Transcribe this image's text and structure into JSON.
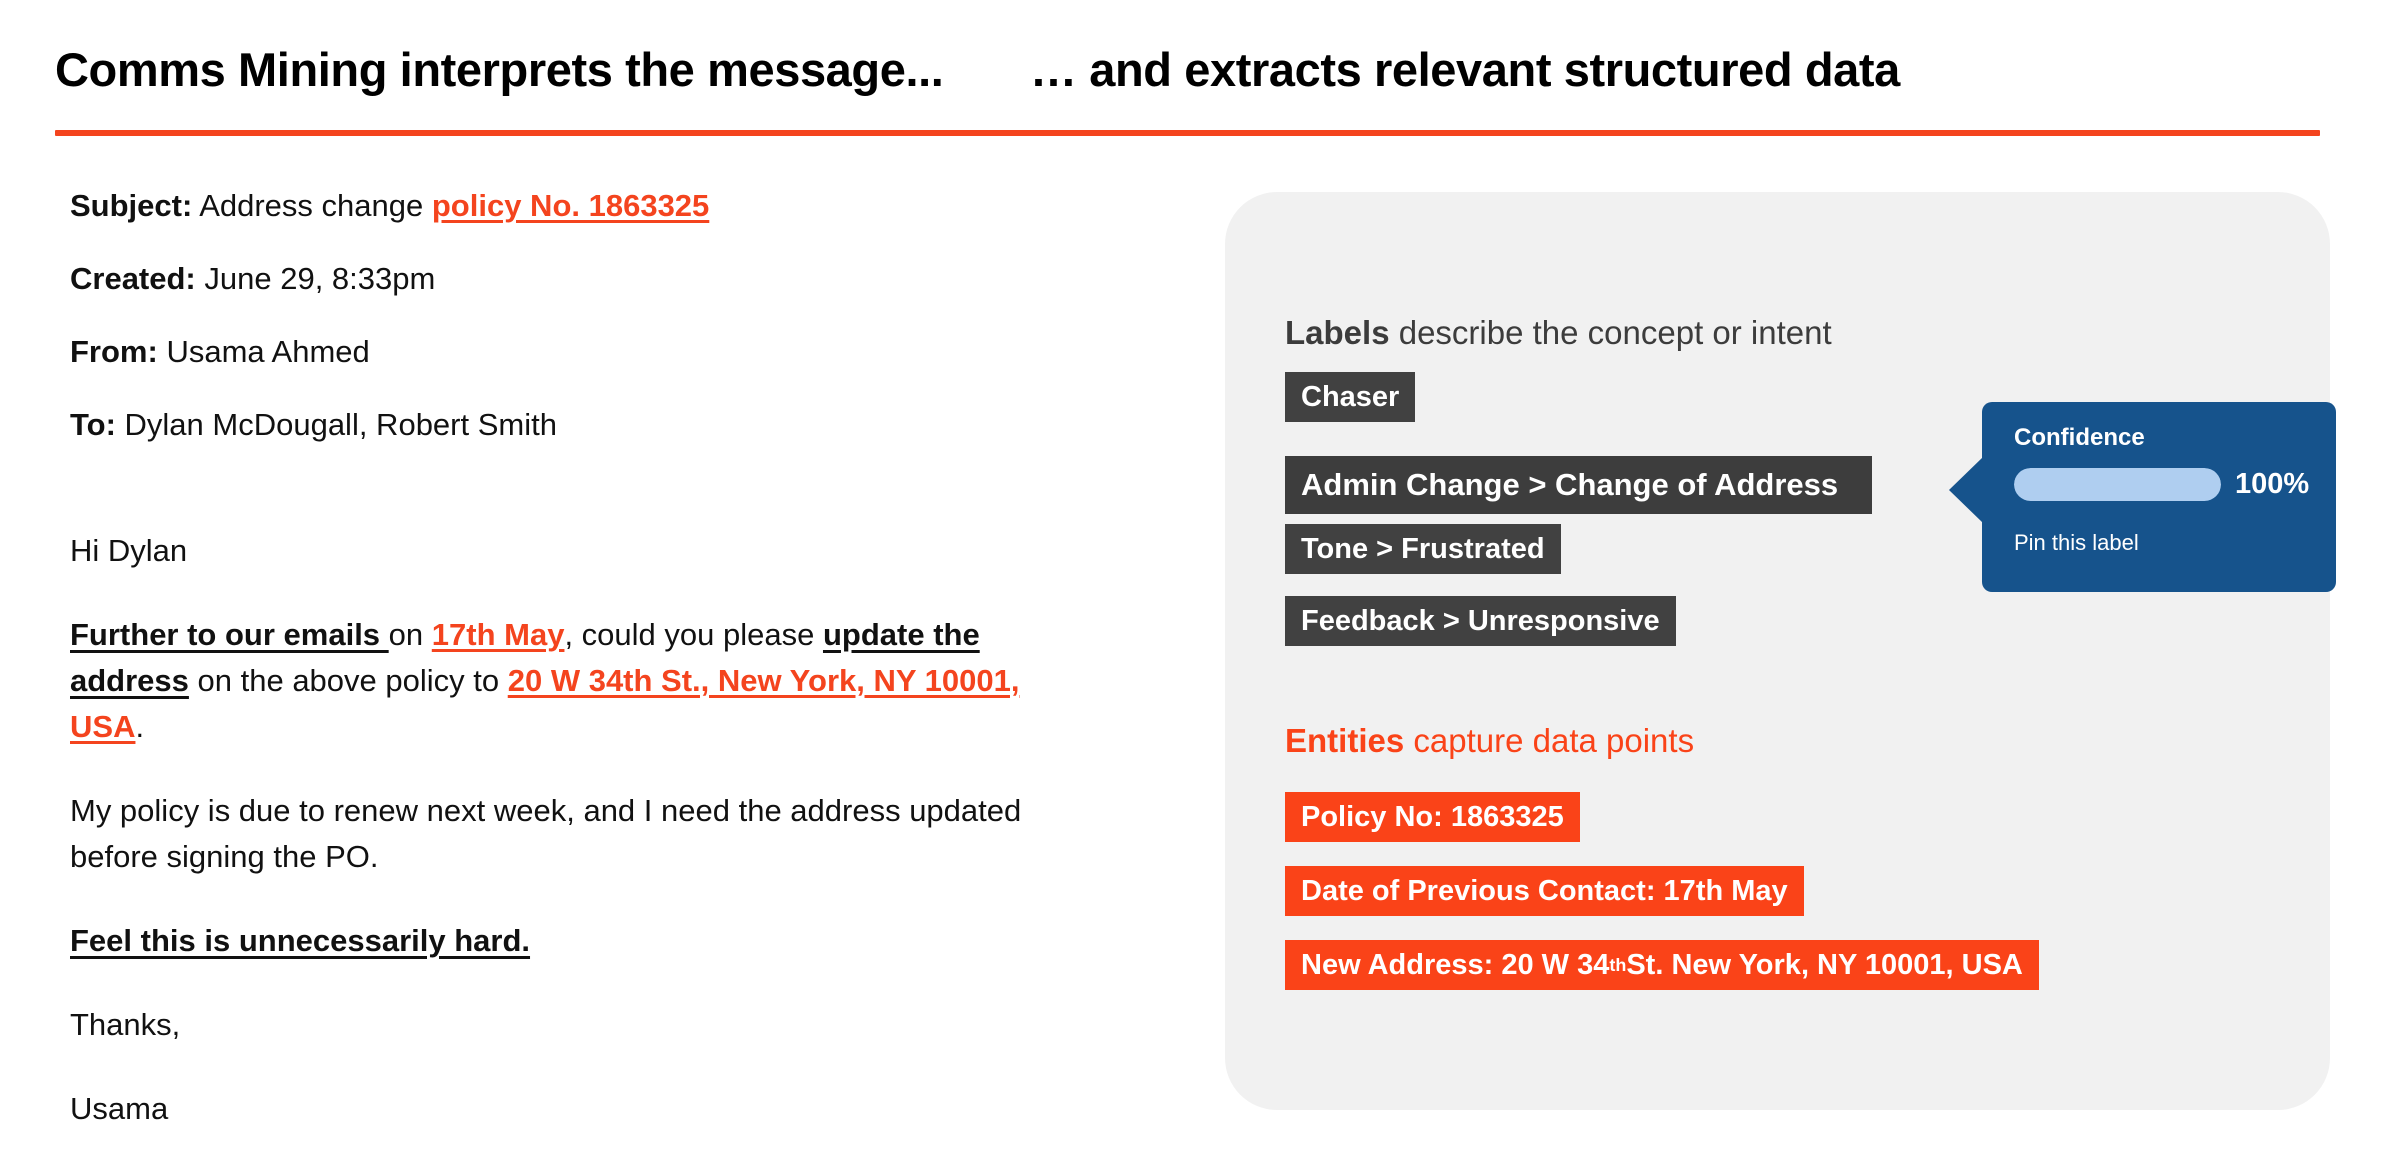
{
  "left_panel": {
    "heading": "Comms Mining interprets the message...",
    "email": {
      "meta": [
        {
          "label": "Subject:",
          "value": " Address change ",
          "entity": "policy No. 1863325"
        },
        {
          "label": "Created:",
          "value": " June 29, 8:33pm",
          "entity": ""
        },
        {
          "label": "From:",
          "value": " Usama Ahmed",
          "entity": ""
        },
        {
          "label": "To:",
          "value": " Dylan McDougall, Robert Smith",
          "entity": ""
        }
      ],
      "body": {
        "greeting": "Hi Dylan",
        "p1_a": "Further to our emails ",
        "p1_b": "on ",
        "p1_date": "17th May",
        "p1_c": ", could you please ",
        "p1_bold": "update the address",
        "p1_d": " on the above policy to ",
        "p1_address": "20 W 34th St., New York, NY 10001, USA",
        "p1_e": ".",
        "p2": "My policy is due to renew next week, and I need the address updated before signing the PO.",
        "p3": "Feel this is unnecessarily hard. ",
        "p4": "Thanks,",
        "p5": "Usama"
      }
    }
  },
  "right_panel": {
    "heading": "… and extracts relevant structured data",
    "labels_section": {
      "title_bold": "Labels",
      "title_rest": " describe the concept or intent",
      "chips": [
        {
          "text": "Chaser",
          "highlighted": false
        },
        {
          "text": "Admin Change > Change of Address",
          "highlighted": true
        },
        {
          "text": "Tone > Frustrated",
          "highlighted": false
        },
        {
          "text": "Feedback > Unresponsive",
          "highlighted": false
        }
      ]
    },
    "entities_section": {
      "title_bold": "Entities",
      "title_rest": " capture data points",
      "chips": [
        {
          "prefix": "Policy No: 1863325",
          "sup": "",
          "suffix": ""
        },
        {
          "prefix": "Date of Previous Contact: 17th May",
          "sup": "",
          "suffix": ""
        },
        {
          "prefix": "New Address: 20 W 34",
          "sup": "th",
          "suffix": " St. New York, NY 10001, USA"
        }
      ]
    },
    "tooltip": {
      "title": "Confidence",
      "percent": "100%",
      "percent_value": 100,
      "link": "Pin this label"
    }
  },
  "colors": {
    "accent_orange": "#F4441E",
    "entity_orange": "#FA4318",
    "label_dark": "#414141",
    "tooltip_blue": "#16538C",
    "bar_light_blue": "#AFCEF0",
    "card_gray": "#F1F1F1"
  }
}
